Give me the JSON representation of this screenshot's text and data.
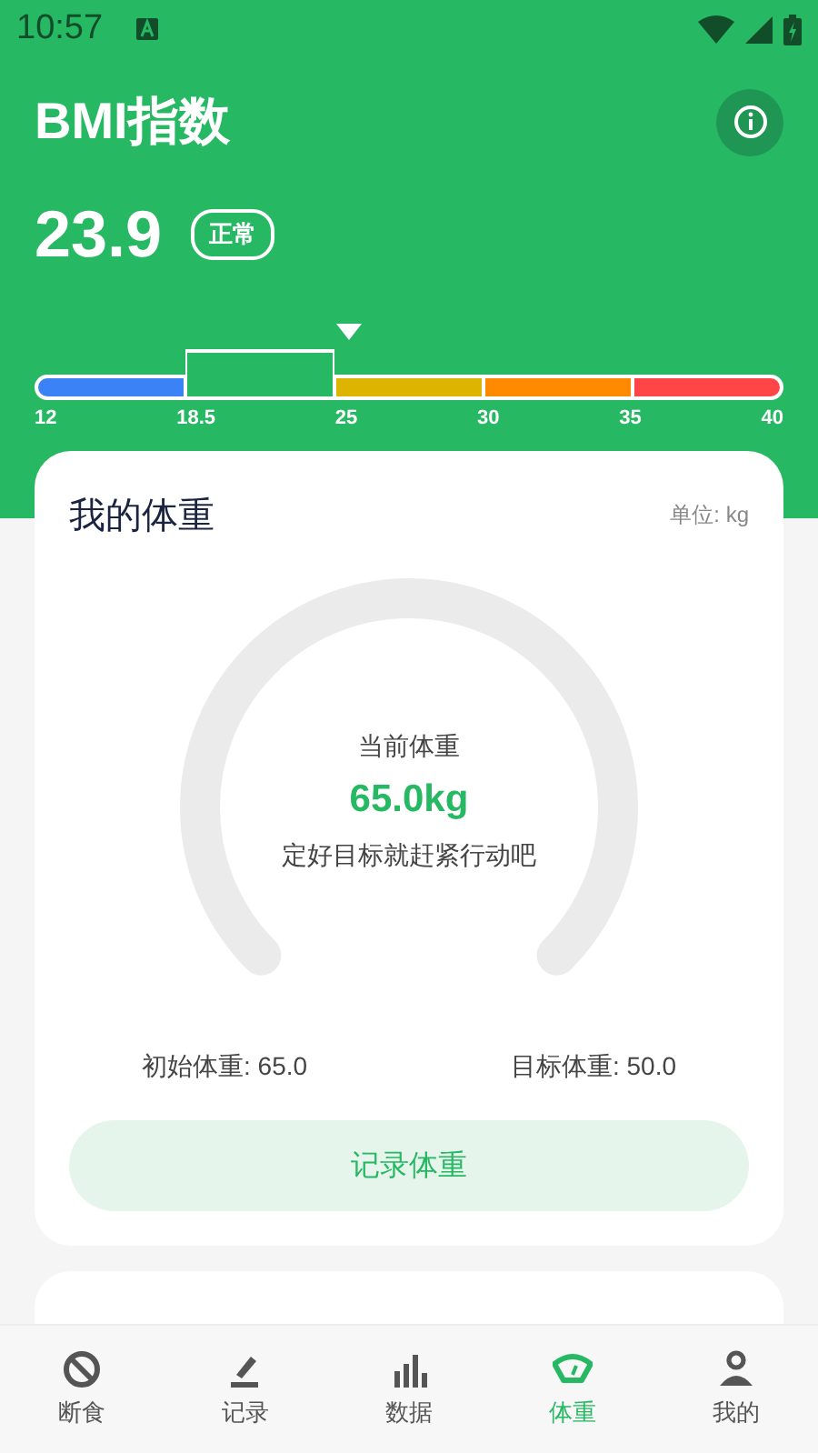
{
  "status_bar": {
    "time": "10:57"
  },
  "header": {
    "title": "BMI指数",
    "value": "23.9",
    "category": "正常"
  },
  "bmi_scale": {
    "segments": [
      {
        "color": "#3b82f6",
        "selected": false
      },
      {
        "color": "#27b864",
        "selected": true
      },
      {
        "color": "#ddb400",
        "selected": false
      },
      {
        "color": "#ff8a00",
        "selected": false
      },
      {
        "color": "#ff4545",
        "selected": false
      }
    ],
    "ticks": [
      "12",
      "18.5",
      "25",
      "30",
      "35",
      "40"
    ]
  },
  "weight_card": {
    "title": "我的体重",
    "unit": "单位: kg",
    "gauge_label": "当前体重",
    "current": "65.0kg",
    "hint": "定好目标就赶紧行动吧",
    "initial": "初始体重: 65.0",
    "target": "目标体重: 50.0",
    "button": "记录体重"
  },
  "nav": [
    {
      "label": "断食",
      "selected": false
    },
    {
      "label": "记录",
      "selected": false
    },
    {
      "label": "数据",
      "selected": false
    },
    {
      "label": "体重",
      "selected": true
    },
    {
      "label": "我的",
      "selected": false
    }
  ]
}
